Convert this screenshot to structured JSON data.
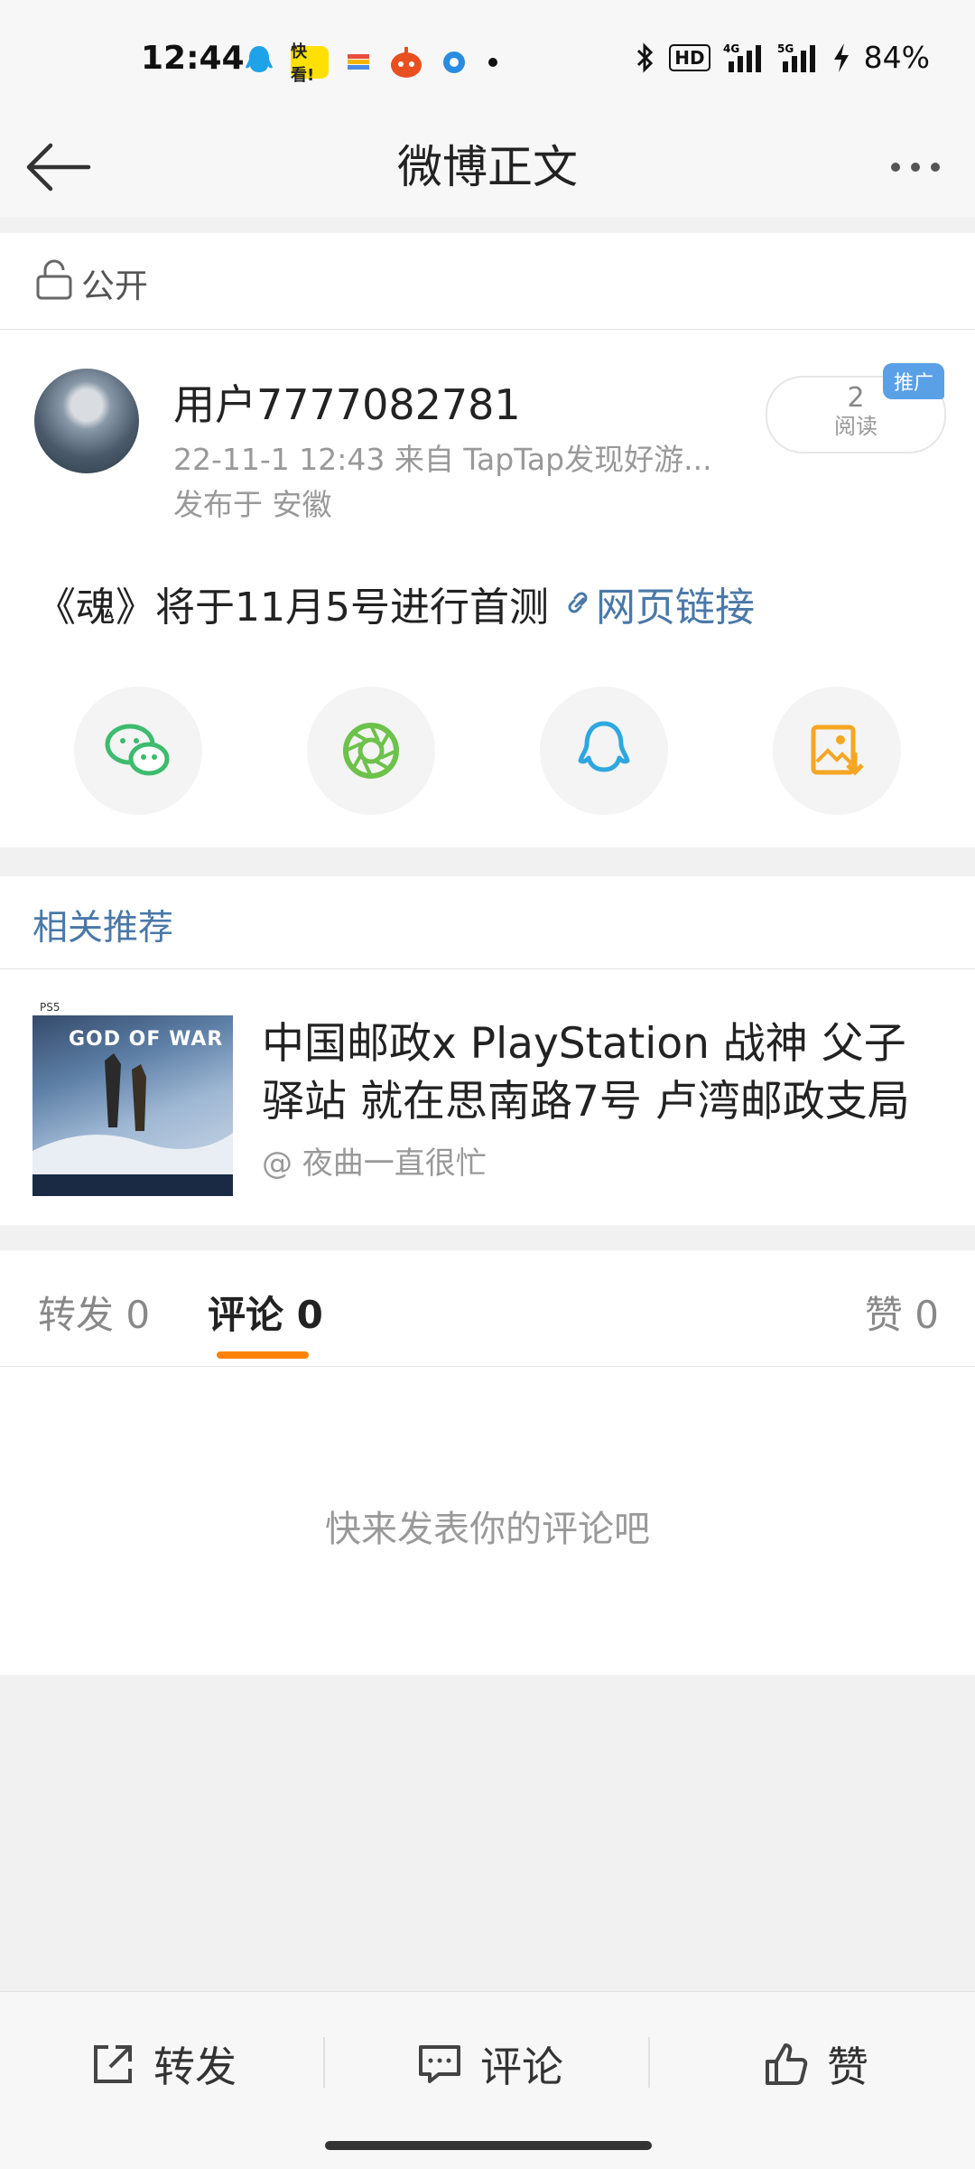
{
  "status_bar": {
    "time": "12:44",
    "battery": "84%",
    "notif_icons": [
      "qq-icon",
      "kuaishou-icon",
      "app-icon",
      "taobao-icon",
      "circle-app-icon",
      "dot-icon"
    ],
    "app_badge": "快看!",
    "net_icons": [
      "bluetooth-icon",
      "hd-icon",
      "signal-4g-icon",
      "signal-5g-icon",
      "charging-icon"
    ]
  },
  "nav": {
    "title": "微博正文"
  },
  "visibility": {
    "label": "公开"
  },
  "post": {
    "username": "用户7777082781",
    "meta": "22-11-1 12:43   来自 TapTap发现好游...",
    "location": "发布于 安徽",
    "read_count": "2",
    "read_label": "阅读",
    "promo_badge": "推广",
    "text": "《魂》将于11月5号进行首测",
    "link_label": "网页链接"
  },
  "share": {
    "items": [
      "wechat-icon",
      "moments-icon",
      "qq-icon",
      "save-image-icon"
    ],
    "colors": {
      "wechat": "#3dbb6e",
      "moments": "#6cc24a",
      "qq": "#2ea7e0",
      "save": "#f5a623"
    }
  },
  "related": {
    "title": "相关推荐",
    "item": {
      "title": "中国邮政x PlayStation 战神 父子驿站 就在思南路7号 卢湾邮政支局",
      "author": "@ 夜曲一直很忙",
      "thumb_text": "GOD OF WAR"
    }
  },
  "tabs": {
    "repost": "转发 0",
    "comment": "评论 0",
    "like": "赞 0"
  },
  "comments": {
    "empty": "快来发表你的评论吧"
  },
  "bottom": {
    "repost": "转发",
    "comment": "评论",
    "like": "赞"
  },
  "colors": {
    "accent": "#ff8200",
    "link": "#4a78a8"
  }
}
